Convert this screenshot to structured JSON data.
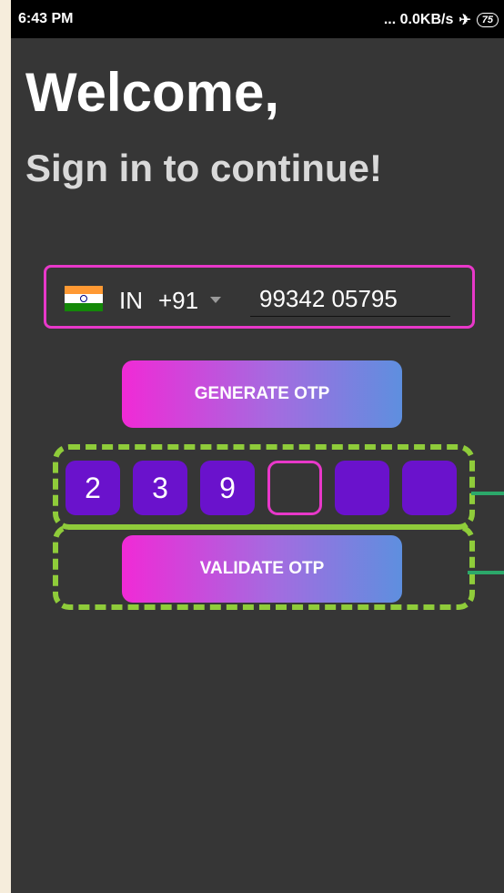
{
  "status_bar": {
    "time": "6:43 PM",
    "network": "... 0.0KB/s",
    "airplane_icon": "airplane-icon",
    "battery": "75"
  },
  "header": {
    "title": "Welcome,",
    "subtitle": "Sign in to continue!"
  },
  "phone_input": {
    "flag_icon": "india-flag-icon",
    "country_code": "IN",
    "dial_code": "+91",
    "number": "99342 05795"
  },
  "buttons": {
    "generate": "GENERATE OTP",
    "validate": "VALIDATE OTP"
  },
  "otp": {
    "digits": [
      "2",
      "3",
      "9",
      "",
      "",
      ""
    ],
    "active_index": 3
  },
  "colors": {
    "background": "#363636",
    "accent_pink": "#e838c9",
    "otp_purple": "#6a12cc",
    "annotation_green": "#8fcc3a"
  }
}
